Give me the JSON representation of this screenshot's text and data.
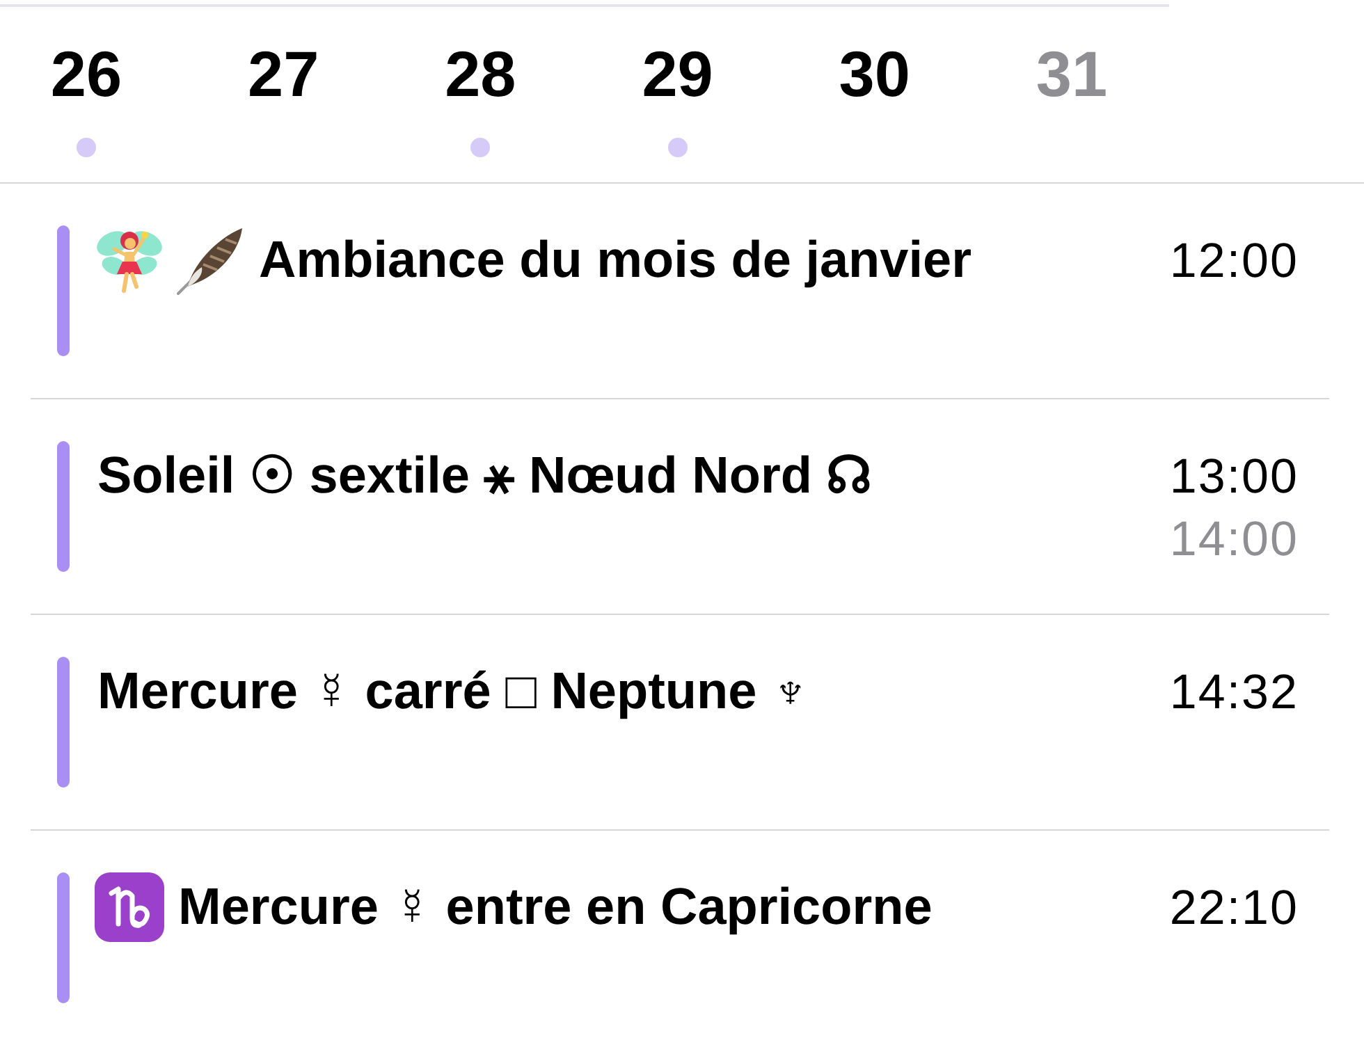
{
  "week": {
    "days": [
      {
        "number": "26",
        "has_event": true,
        "weekend": false
      },
      {
        "number": "27",
        "has_event": false,
        "weekend": false
      },
      {
        "number": "28",
        "has_event": true,
        "weekend": false
      },
      {
        "number": "29",
        "has_event": true,
        "weekend": false
      },
      {
        "number": "30",
        "has_event": false,
        "weekend": false
      },
      {
        "number": "31",
        "has_event": false,
        "weekend": true
      }
    ]
  },
  "events": [
    {
      "kind": "mood",
      "title": "Ambiance du mois de janvier",
      "time": "12:00"
    },
    {
      "kind": "aspect",
      "title": "Soleil ☉ sextile ⚹ Nœud Nord ☊",
      "time": "13:00",
      "end_time": "14:00"
    },
    {
      "kind": "aspect",
      "title": "Mercure ☿ carré □ Neptune ♆",
      "time": "14:32"
    },
    {
      "kind": "ingress",
      "title": "Mercure ☿ entre en Capricorne",
      "time": "22:10"
    }
  ]
}
